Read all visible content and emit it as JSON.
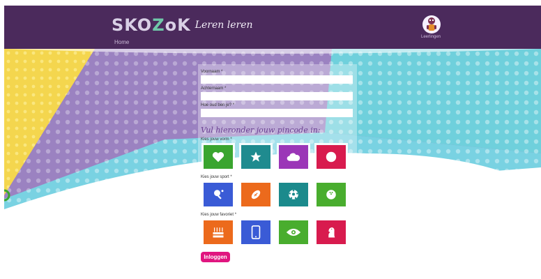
{
  "header": {
    "logo": {
      "prefix": "SKO",
      "o": "Z",
      "suffix": "oK"
    },
    "slogan": "Leren leren",
    "nav": {
      "home": "Home"
    },
    "avatar": {
      "caption": "Leerlingen",
      "icon": "student-character-icon"
    },
    "colors": {
      "bar": "#4b2a5c",
      "logo": "#d9d0e6",
      "logo_accent": "#6fc7a9"
    }
  },
  "form": {
    "first_name": {
      "label": "Voornaam *",
      "value": ""
    },
    "last_name": {
      "label": "Achternaam *",
      "value": ""
    },
    "age": {
      "label": "Hoe oud ben je? *",
      "value": ""
    },
    "pin_heading": "Vul hieronder jouw pincode in:",
    "shape": {
      "label": "Kies jouw vorm *",
      "tiles": [
        {
          "icon": "heart-icon",
          "color": "#3aa52f",
          "selected": true
        },
        {
          "icon": "star-icon",
          "color": "#1f8b8f",
          "selected": true
        },
        {
          "icon": "cloud-icon",
          "color": "#9b36b7",
          "selected": true
        },
        {
          "icon": "circle-icon",
          "color": "#d81b4e",
          "selected": true
        }
      ]
    },
    "sport": {
      "label": "Kies jouw sport *",
      "tiles": [
        {
          "icon": "table-tennis-icon",
          "color": "#3a5bd6"
        },
        {
          "icon": "american-football-icon",
          "color": "#ec6a1c"
        },
        {
          "icon": "soccer-ball-icon",
          "color": "#1b8a8c"
        },
        {
          "icon": "bowling-ball-icon",
          "color": "#49ad2e"
        }
      ]
    },
    "favorite": {
      "label": "Kies jouw favoriet *",
      "tiles": [
        {
          "icon": "birthday-cake-icon",
          "color": "#ec6a1c"
        },
        {
          "icon": "smartphone-icon",
          "color": "#3a5bd6"
        },
        {
          "icon": "eye-icon",
          "color": "#49ad2e"
        },
        {
          "icon": "chess-knight-icon",
          "color": "#d81b4e"
        }
      ]
    },
    "submit": {
      "label": "Inloggen",
      "color": "#e0157f"
    }
  }
}
